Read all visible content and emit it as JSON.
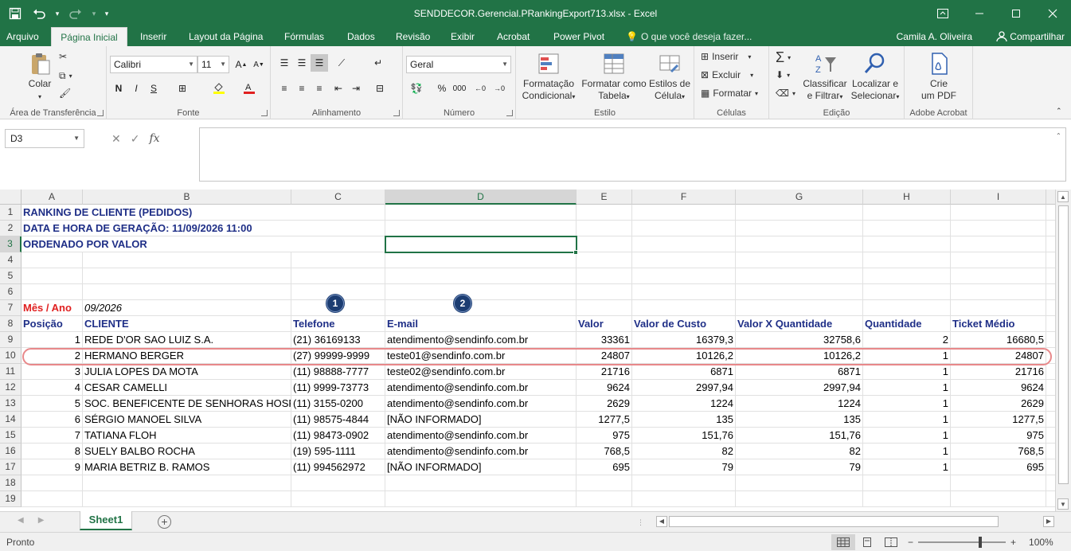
{
  "window": {
    "title": "SENDDECOR.Gerencial.PRankingExport713.xlsx - Excel"
  },
  "ribbon_tabs": [
    "Arquivo",
    "Página Inicial",
    "Inserir",
    "Layout da Página",
    "Fórmulas",
    "Dados",
    "Revisão",
    "Exibir",
    "Acrobat",
    "Power Pivot"
  ],
  "tell_me": "O que você deseja fazer...",
  "user_name": "Camila A. Oliveira",
  "share_label": "Compartilhar",
  "ribbon": {
    "clipboard": {
      "label": "Área de Transferência",
      "paste": "Colar"
    },
    "font": {
      "label": "Fonte",
      "name": "Calibri",
      "size": "11",
      "bold": "N",
      "italic": "I",
      "underline": "S"
    },
    "alignment": {
      "label": "Alinhamento"
    },
    "number": {
      "label": "Número",
      "format": "Geral",
      "percent": "%",
      "thousands": "000"
    },
    "styles": {
      "label": "Estilo",
      "conditional_1": "Formatação",
      "conditional_2": "Condicional",
      "table_1": "Formatar como",
      "table_2": "Tabela",
      "cell_1": "Estilos de",
      "cell_2": "Célula"
    },
    "cells": {
      "label": "Células",
      "insert": "Inserir",
      "delete": "Excluir",
      "format": "Formatar"
    },
    "editing": {
      "label": "Edição",
      "sort_1": "Classificar",
      "sort_2": "e Filtrar",
      "find_1": "Localizar e",
      "find_2": "Selecionar"
    },
    "acrobat": {
      "label": "Adobe Acrobat",
      "create_1": "Crie",
      "create_2": "um PDF"
    }
  },
  "formula_bar": {
    "name_box": "D3",
    "fx": "fx",
    "content": ""
  },
  "columns": [
    "A",
    "B",
    "C",
    "D",
    "E",
    "F",
    "G",
    "H",
    "I"
  ],
  "selected_column": "D",
  "rows": [
    "1",
    "2",
    "3",
    "4",
    "5",
    "6",
    "7",
    "8",
    "9",
    "10",
    "11",
    "12",
    "13",
    "14",
    "15",
    "16",
    "17",
    "18",
    "19"
  ],
  "selected_row": "3",
  "sheet": {
    "title_1": "RANKING DE CLIENTE (PEDIDOS)",
    "title_2": "DATA E HORA DE GERAÇÃO: 11/09/2026 11:00",
    "title_3": "ORDENADO POR VALOR",
    "period_label": "Mês / Ano",
    "period_value": "09/2026",
    "headers": [
      "Posição",
      "CLIENTE",
      "Telefone",
      "E-mail",
      "Valor",
      "Valor de Custo",
      "Valor X Quantidade",
      "Quantidade",
      "Ticket Médio"
    ],
    "records": [
      {
        "pos": "1",
        "cliente": "REDE D'OR SAO LUIZ S.A.",
        "telefone": "(21) 36169133",
        "email": "atendimento@sendinfo.com.br",
        "valor": "33361",
        "custo": "16379,3",
        "vxq": "32758,6",
        "qtd": "2",
        "ticket": "16680,5"
      },
      {
        "pos": "2",
        "cliente": "HERMANO BERGER",
        "telefone": "(27) 99999-9999",
        "email": "teste01@sendinfo.com.br",
        "valor": "24807",
        "custo": "10126,2",
        "vxq": "10126,2",
        "qtd": "1",
        "ticket": "24807"
      },
      {
        "pos": "3",
        "cliente": "JULIA LOPES DA MOTA",
        "telefone": "(11) 98888-7777",
        "email": "teste02@sendinfo.com.br",
        "valor": "21716",
        "custo": "6871",
        "vxq": "6871",
        "qtd": "1",
        "ticket": "21716"
      },
      {
        "pos": "4",
        "cliente": "CESAR CAMELLI",
        "telefone": "(11) 9999-73773",
        "email": "atendimento@sendinfo.com.br",
        "valor": "9624",
        "custo": "2997,94",
        "vxq": "2997,94",
        "qtd": "1",
        "ticket": "9624"
      },
      {
        "pos": "5",
        "cliente": "SOC. BENEFICENTE DE SENHORAS HOSP. SÍ",
        "telefone": "(11) 3155-0200",
        "email": "atendimento@sendinfo.com.br",
        "valor": "2629",
        "custo": "1224",
        "vxq": "1224",
        "qtd": "1",
        "ticket": "2629"
      },
      {
        "pos": "6",
        "cliente": "SÉRGIO MANOEL SILVA",
        "telefone": "(11) 98575-4844",
        "email": "[NÃO INFORMADO]",
        "valor": "1277,5",
        "custo": "135",
        "vxq": "135",
        "qtd": "1",
        "ticket": "1277,5"
      },
      {
        "pos": "7",
        "cliente": "TATIANA FLOH",
        "telefone": "(11) 98473-0902",
        "email": "atendimento@sendinfo.com.br",
        "valor": "975",
        "custo": "151,76",
        "vxq": "151,76",
        "qtd": "1",
        "ticket": "975"
      },
      {
        "pos": "8",
        "cliente": "SUELY BALBO ROCHA",
        "telefone": "(19) 595-1111",
        "email": "atendimento@sendinfo.com.br",
        "valor": "768,5",
        "custo": "82",
        "vxq": "82",
        "qtd": "1",
        "ticket": "768,5"
      },
      {
        "pos": "9",
        "cliente": "MARIA BETRIZ B. RAMOS",
        "telefone": "(11) 994562972",
        "email": "[NÃO INFORMADO]",
        "valor": "695",
        "custo": "79",
        "vxq": "79",
        "qtd": "1",
        "ticket": "695"
      }
    ]
  },
  "markers": [
    "1",
    "2"
  ],
  "sheet_tab": "Sheet1",
  "status": "Pronto",
  "zoom": "100%",
  "colors": {
    "excel_green": "#217346",
    "header_blue": "#1f2f87",
    "label_red": "#e02020",
    "marker_navy": "#1c3d72",
    "highlight_pink": "#e8888a"
  }
}
